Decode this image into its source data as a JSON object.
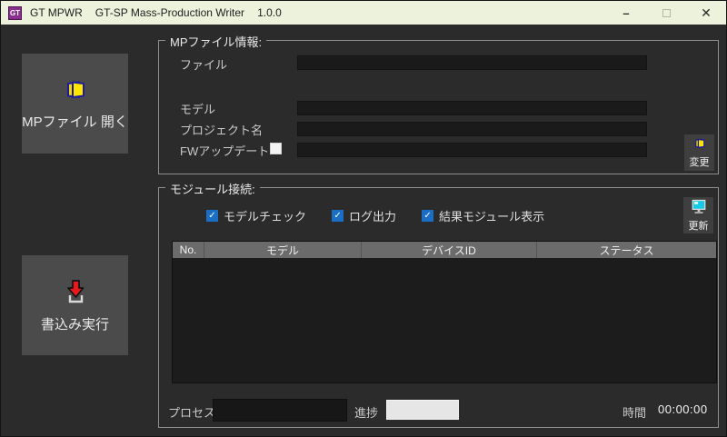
{
  "window": {
    "icon_text": "GT",
    "title_app": "GT MPWR",
    "title_product": "GT-SP Mass-Production Writer",
    "title_version": "1.0.0",
    "minimize_glyph": "–",
    "close_glyph": "✕"
  },
  "colors": {
    "titlebar_bg": "#edf2dc",
    "client_bg": "#2b2b2b",
    "button_bg": "#4b4b4b",
    "field_bg": "#1a1a1a",
    "table_header_bg": "#6b6b6b",
    "checkbox_checked": "#1a6ec6",
    "folder_icon_yellow": "#ffe600",
    "folder_icon_outline": "#1c1c9c",
    "write_arrow_red": "#e8191d",
    "monitor_screen_cyan": "#16cbe8",
    "app_icon_purple": "#8a2f90"
  },
  "left_panel": {
    "open_button_label": "MPファイル 開く",
    "write_button_label": "書込み実行"
  },
  "mp_file_info": {
    "group_label": "MPファイル情報:",
    "fields": [
      {
        "label": "ファイル",
        "value": ""
      },
      {
        "label": "モデル",
        "value": ""
      },
      {
        "label": "プロジェクト名",
        "value": ""
      },
      {
        "label": "FWアップデート",
        "value": "",
        "checked": false
      }
    ],
    "change_button_label": "変更"
  },
  "module_connection": {
    "group_label": "モジュール接続:",
    "checkboxes": [
      {
        "label": "モデルチェック",
        "checked": true
      },
      {
        "label": "ログ出力",
        "checked": true
      },
      {
        "label": "結果モジュール表示",
        "checked": true
      }
    ],
    "update_button_label": "更新",
    "table": {
      "columns": [
        "No.",
        "モデル",
        "デバイスID",
        "ステータス"
      ],
      "rows": []
    },
    "status_bar": {
      "process_label": "プロセス",
      "process_value": "",
      "progress_label": "進捗",
      "progress_percent": 0,
      "time_label": "時間",
      "time_value": "00:00:00"
    }
  }
}
